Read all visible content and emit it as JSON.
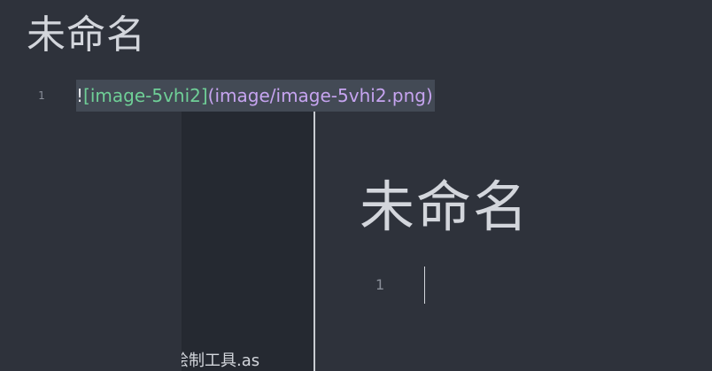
{
  "document": {
    "title": "未命名"
  },
  "editor": {
    "lines": [
      {
        "number": "1",
        "bang": "!",
        "alt_text": "[image-5vhi2]",
        "url": "(image/image-5vhi2.png)"
      }
    ]
  },
  "preview": {
    "sidebar_text": "绘制工具.as",
    "title": "未命名",
    "line_number": "1"
  },
  "colors": {
    "background": "#2e323b",
    "sidebar": "#252931",
    "line_highlight": "#434a55",
    "alt_text": "#6fcf97",
    "url": "#c6a4f0",
    "text": "#d3d6dc",
    "line_number": "#8a8f99"
  }
}
